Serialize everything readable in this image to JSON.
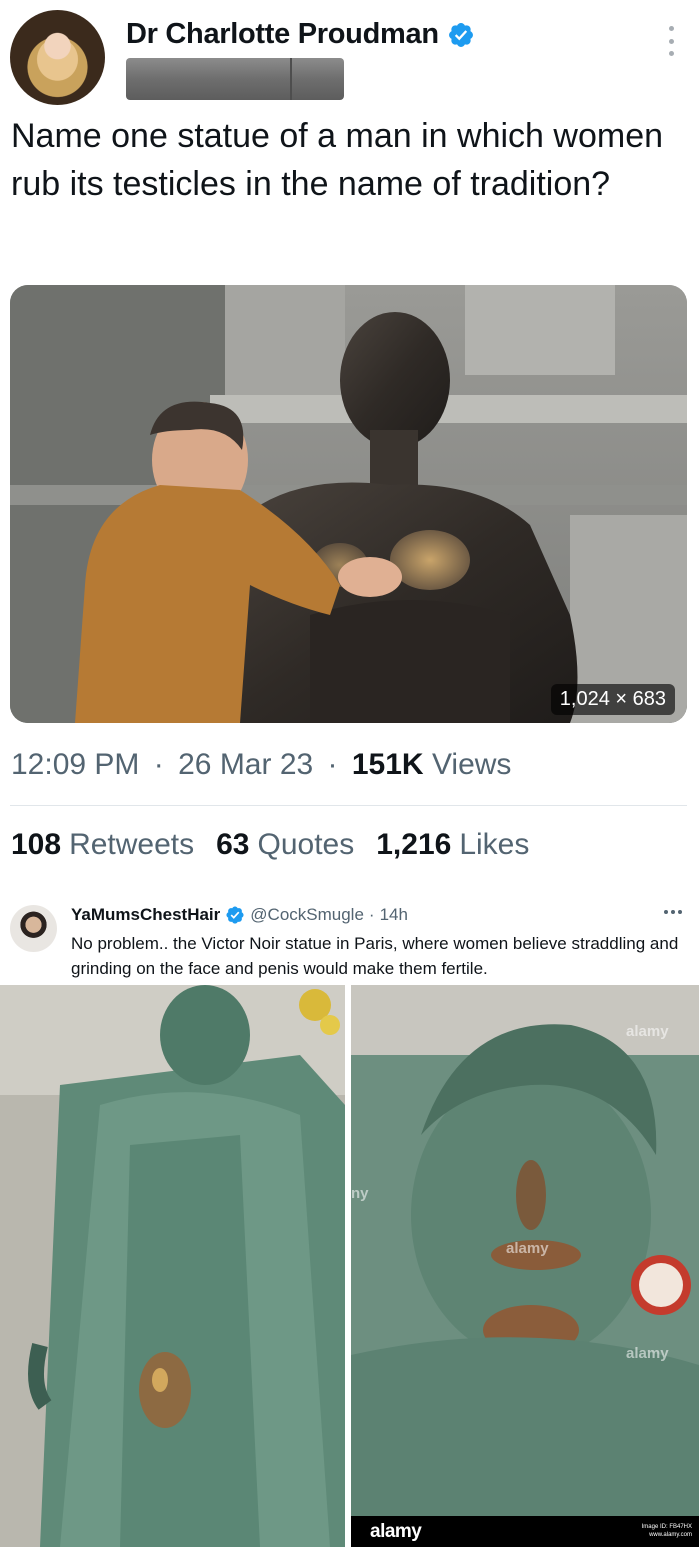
{
  "tweet": {
    "author_name": "Dr Charlotte Proudman",
    "text": "Name one statue of a man in which women rub its testicles in the name of tradition?",
    "media_dimensions": "1,024 × 683",
    "time": "12:09 PM",
    "date": "26 Mar 23",
    "views_count": "151K",
    "views_label": "Views",
    "retweets_count": "108",
    "retweets_label": "Retweets",
    "quotes_count": "63",
    "quotes_label": "Quotes",
    "likes_count": "1,216",
    "likes_label": "Likes",
    "separator": "·"
  },
  "reply": {
    "author_name": "YaMumsChestHair",
    "handle": "@CockSmugle",
    "age": "14h",
    "separator": "·",
    "text": "No problem.. the Victor Noir statue in Paris, where women believe straddling and grinding on the face and penis would make them fertile."
  },
  "watermarks": {
    "alamy": "alamy",
    "alamy_partial": "ny",
    "image_id": "Image ID: FB47HX",
    "site": "www.alamy.com"
  },
  "colors": {
    "verified_blue": "#1d9bf0",
    "text_primary": "#0f1419",
    "text_secondary": "#536471"
  },
  "icons": {
    "verified": "verified-badge-icon",
    "more": "more-options-icon"
  }
}
